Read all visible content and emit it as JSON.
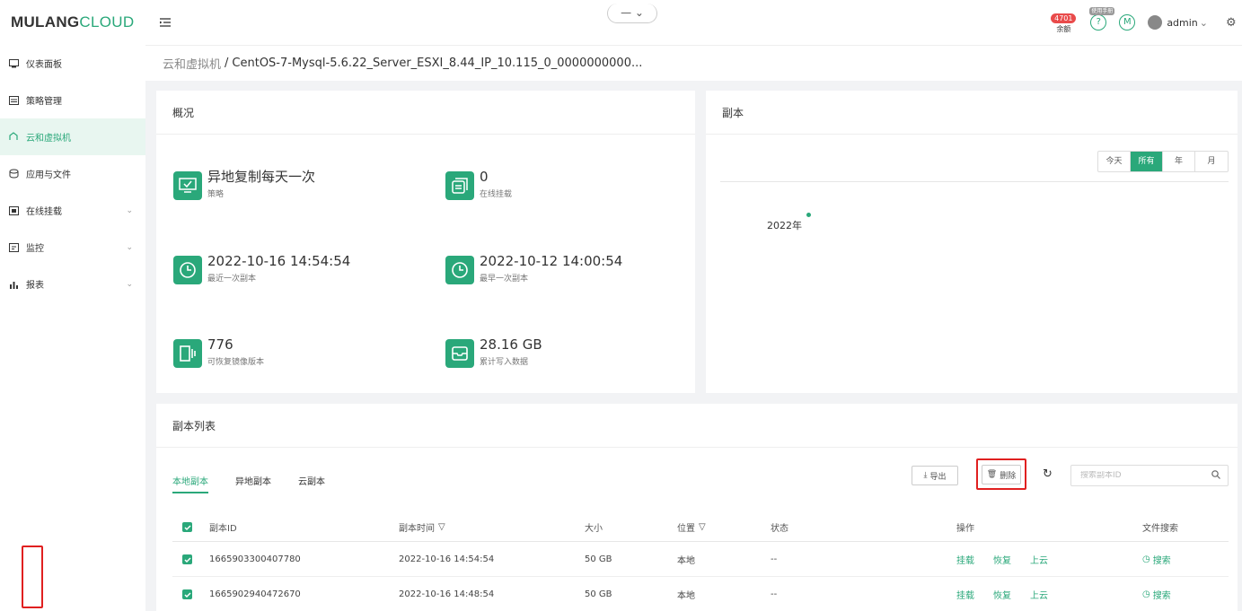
{
  "app": {
    "logo_part1": "MUL",
    "logo_mark": "A",
    "logo_part2": "NG",
    "logo_part3": "CLOUD"
  },
  "sidebar": {
    "items": [
      {
        "label": "仪表面板",
        "icon": "dashboard-icon"
      },
      {
        "label": "策略管理",
        "icon": "policy-icon"
      },
      {
        "label": "云和虚拟机",
        "icon": "cloud-vm-icon"
      },
      {
        "label": "应用与文件",
        "icon": "app-file-icon"
      },
      {
        "label": "在线挂载",
        "icon": "mount-icon"
      },
      {
        "label": "监控",
        "icon": "monitor-icon"
      },
      {
        "label": "报表",
        "icon": "report-icon"
      }
    ],
    "active_index": 2
  },
  "header": {
    "center_tab": "— ⌄",
    "balance_badge": "4701",
    "balance_label": "余额",
    "icon_tag": "使用手册",
    "user": "admin"
  },
  "breadcrumb": {
    "parent": "云和虚拟机",
    "separator": "/",
    "current": "CentOS-7-Mysql-5.6.22_Server_ESXI_8.44_IP_10.115_0_0000000000..."
  },
  "overview": {
    "title": "概况",
    "stats": [
      {
        "value": "异地复制每天一次",
        "label": "策略"
      },
      {
        "value": "0",
        "label": "在线挂载"
      },
      {
        "value": "2022-10-16 14:54:54",
        "label": "最近一次副本"
      },
      {
        "value": "2022-10-12 14:00:54",
        "label": "最早一次副本"
      },
      {
        "value": "776",
        "label": "可恢复镜像版本"
      },
      {
        "value": "28.16 GB",
        "label": "累计写入数据"
      }
    ]
  },
  "replica": {
    "title": "副本",
    "filters": [
      "今天",
      "所有",
      "年",
      "月"
    ],
    "active_filter": 1,
    "year": "2022年"
  },
  "list": {
    "title": "副本列表",
    "tabs": [
      "本地副本",
      "异地副本",
      "云副本"
    ],
    "export_label": "导出",
    "delete_label": "删除",
    "search_placeholder": "搜索副本ID",
    "columns": [
      "副本ID",
      "副本时间",
      "大小",
      "位置",
      "状态",
      "操作",
      "文件搜索"
    ],
    "rows": [
      {
        "id": "1665903300407780",
        "time": "2022-10-16 14:54:54",
        "size": "50 GB",
        "location": "本地",
        "status": "--",
        "actions": [
          "挂载",
          "恢复",
          "上云"
        ],
        "search": "搜索"
      },
      {
        "id": "1665902940472670",
        "time": "2022-10-16 14:48:54",
        "size": "50 GB",
        "location": "本地",
        "status": "--",
        "actions": [
          "挂载",
          "恢复",
          "上云"
        ],
        "search": "搜索"
      }
    ]
  },
  "colors": {
    "accent": "#2aa87a",
    "highlight": "#e02020",
    "badge": "#e94b4b"
  }
}
